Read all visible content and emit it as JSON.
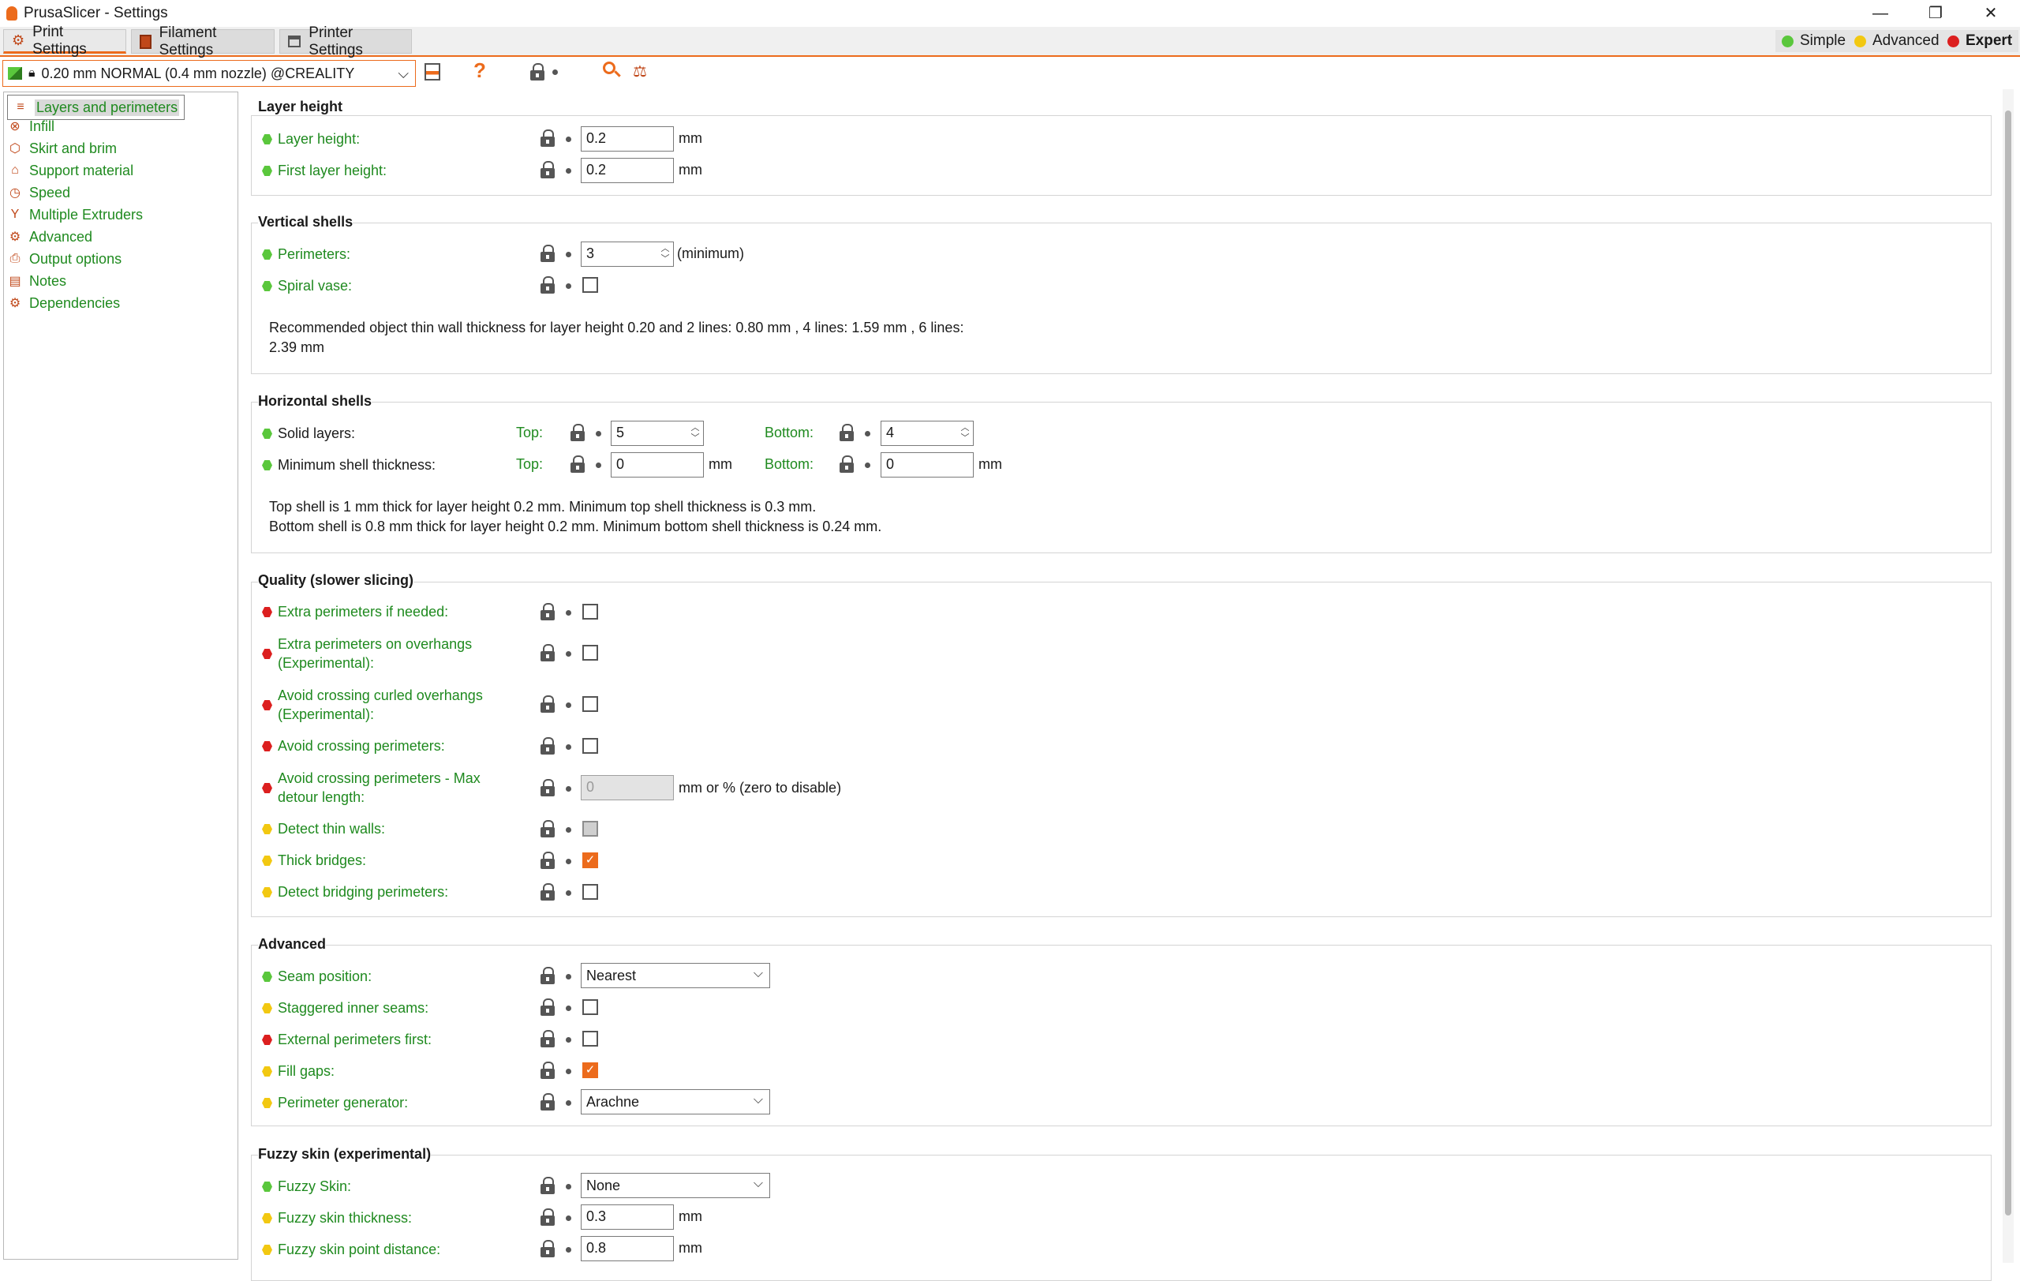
{
  "window": {
    "title": "PrusaSlicer - Settings",
    "minimize": "—",
    "restore": "❐",
    "close": "✕"
  },
  "tabs": [
    {
      "label": "Print Settings",
      "icon": "gear-icon"
    },
    {
      "label": "Filament Settings",
      "icon": "filament-spool-icon"
    },
    {
      "label": "Printer Settings",
      "icon": "printer-icon"
    }
  ],
  "modes": {
    "simple": {
      "label": "Simple",
      "color": "#5ac73c"
    },
    "advanced": {
      "label": "Advanced",
      "color": "#f2c811"
    },
    "expert": {
      "label": "Expert",
      "color": "#dc1f1f"
    }
  },
  "toolbar": {
    "preset": "0.20 mm NORMAL (0.4 mm nozzle) @CREALITY",
    "help": "?"
  },
  "sidebar": {
    "items": [
      {
        "label": "Layers and perimeters",
        "icon": "layers-icon",
        "glyph": "≡"
      },
      {
        "label": "Infill",
        "icon": "infill-icon",
        "glyph": "⊗"
      },
      {
        "label": "Skirt and brim",
        "icon": "skirt-icon",
        "glyph": "⬡"
      },
      {
        "label": "Support material",
        "icon": "support-icon",
        "glyph": "⌂"
      },
      {
        "label": "Speed",
        "icon": "speed-icon",
        "glyph": "◷"
      },
      {
        "label": "Multiple Extruders",
        "icon": "funnel-icon",
        "glyph": "Y"
      },
      {
        "label": "Advanced",
        "icon": "advanced-icon",
        "glyph": "⚙"
      },
      {
        "label": "Output options",
        "icon": "output-icon",
        "glyph": "⎙"
      },
      {
        "label": "Notes",
        "icon": "notes-icon",
        "glyph": "▤"
      },
      {
        "label": "Dependencies",
        "icon": "dependencies-icon",
        "glyph": "⚙"
      }
    ]
  },
  "layer_height": {
    "title": "Layer height",
    "layer_height_label": "Layer height:",
    "layer_height_value": "0.2",
    "first_layer_label": "First layer height:",
    "first_layer_value": "0.2",
    "unit": "mm"
  },
  "vertical_shells": {
    "title": "Vertical shells",
    "perimeters_label": "Perimeters:",
    "perimeters_value": "3",
    "perimeters_suffix": "(minimum)",
    "spiral_label": "Spiral vase:",
    "note_line1": "Recommended object thin wall thickness for layer height 0.20 and 2 lines: 0.80 mm , 4 lines: 1.59 mm , 6 lines:",
    "note_line2": "2.39 mm"
  },
  "horizontal_shells": {
    "title": "Horizontal shells",
    "solid_label": "Solid layers:",
    "top_label": "Top:",
    "bottom_label": "Bottom:",
    "solid_top": "5",
    "solid_bottom": "4",
    "min_label": "Minimum shell thickness:",
    "min_top": "0",
    "min_bottom": "0",
    "unit": "mm",
    "note_line1": "Top shell is 1 mm thick for layer height 0.2 mm. Minimum top shell thickness is 0.3 mm.",
    "note_line2": "Bottom shell is 0.8 mm thick for layer height 0.2 mm. Minimum bottom shell thickness is 0.24 mm."
  },
  "quality": {
    "title": "Quality (slower slicing)",
    "extra_perimeters": "Extra perimeters if needed:",
    "overhangs_line1": "Extra perimeters on overhangs",
    "overhangs_line2": "(Experimental):",
    "curled_line1": "Avoid crossing curled overhangs",
    "curled_line2": "(Experimental):",
    "avoid_crossing": "Avoid crossing perimeters:",
    "detour_line1": "Avoid crossing perimeters - Max",
    "detour_line2": "detour length:",
    "detour_value": "0",
    "detour_unit": "mm or % (zero to disable)",
    "thin_walls": "Detect thin walls:",
    "thick_bridges": "Thick bridges:",
    "bridging": "Detect bridging perimeters:"
  },
  "advanced": {
    "title": "Advanced",
    "seam_label": "Seam position:",
    "seam_value": "Nearest",
    "staggered_label": "Staggered inner seams:",
    "external_first_label": "External perimeters first:",
    "fill_gaps_label": "Fill gaps:",
    "generator_label": "Perimeter generator:",
    "generator_value": "Arachne"
  },
  "fuzzy": {
    "title": "Fuzzy skin (experimental)",
    "skin_label": "Fuzzy Skin:",
    "skin_value": "None",
    "thickness_label": "Fuzzy skin thickness:",
    "thickness_value": "0.3",
    "distance_label": "Fuzzy skin point distance:",
    "distance_value": "0.8",
    "unit": "mm"
  },
  "checkboxes": {
    "spiral_vase": false,
    "extra_perimeters": false,
    "overhangs": false,
    "curled": false,
    "avoid_crossing": false,
    "thin_walls": "indeterminate",
    "thick_bridges": true,
    "bridging": false,
    "staggered": false,
    "external_first": false,
    "fill_gaps": true
  },
  "colors": {
    "accent": "#ec6b1c",
    "label_green": "#1f8a1f",
    "simple": "#5ac73c",
    "advanced": "#f2c811",
    "expert": "#dc1f1f"
  }
}
